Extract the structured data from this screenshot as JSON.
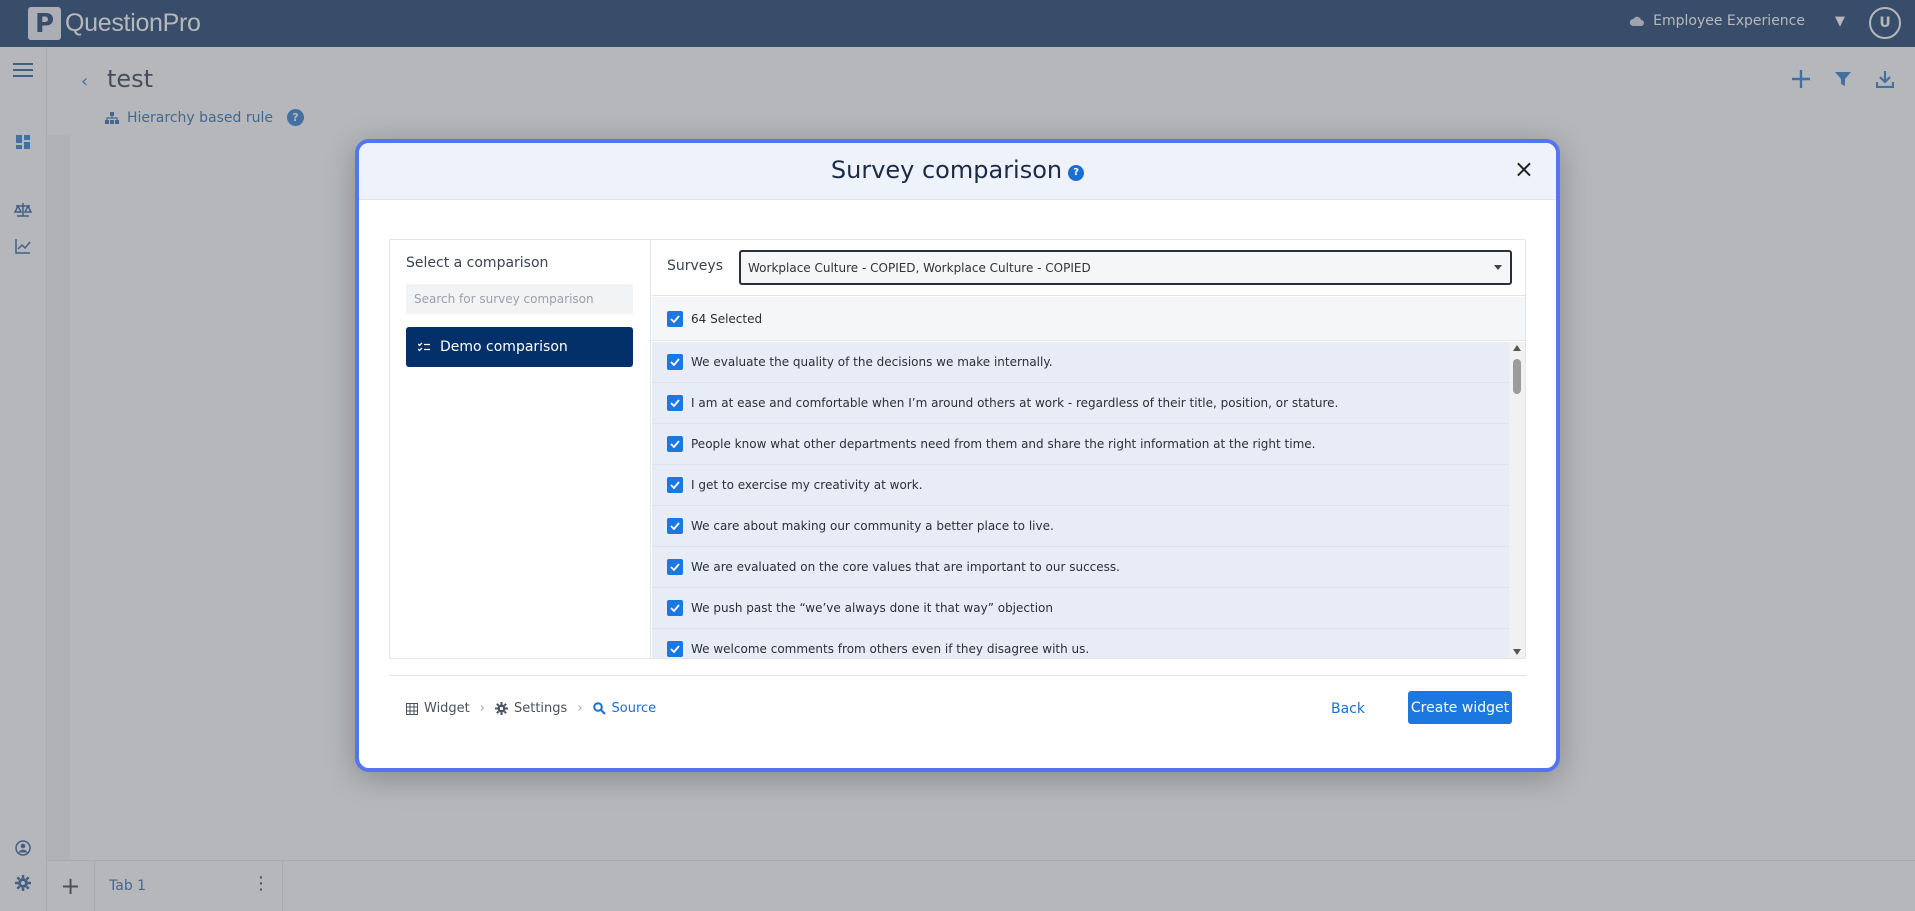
{
  "header": {
    "logo_letter": "P",
    "brand": "QuestionPro",
    "product": "Employee Experience",
    "avatar_initial": "U"
  },
  "page": {
    "title": "test",
    "rule_link": "Hierarchy based rule",
    "help": "?"
  },
  "tabs": {
    "add": "+",
    "items": [
      {
        "label": "Tab 1"
      }
    ]
  },
  "modal": {
    "title": "Survey comparison",
    "help": "?",
    "close": "×",
    "left": {
      "label": "Select a comparison",
      "search_placeholder": "Search for survey comparison",
      "selected_item": "Demo comparison"
    },
    "surveys_label": "Surveys",
    "surveys_value": "Workplace Culture - COPIED, Workplace Culture - COPIED",
    "selected_count": "64 Selected",
    "questions": [
      "We evaluate the quality of the decisions we make internally.",
      "I am at ease and comfortable when I’m around others at work - regardless of their title, position, or stature.",
      "People know what other departments need from them and share the right information at the right time.",
      "I get to exercise my creativity at work.",
      "We care about making our community a better place to live.",
      "We are evaluated on the core values that are important to our success.",
      "We push past the “we’ve always done it that way” objection",
      "We welcome comments from others even if they disagree with us."
    ],
    "steps": {
      "widget": "Widget",
      "settings": "Settings",
      "source": "Source",
      "separator": "›"
    },
    "back_label": "Back",
    "create_label": "Create widget"
  },
  "colors": {
    "topbar": "#032b5c",
    "accent": "#1a78e0",
    "modal_border": "#5474f0",
    "selected_item_bg": "#04306a"
  }
}
